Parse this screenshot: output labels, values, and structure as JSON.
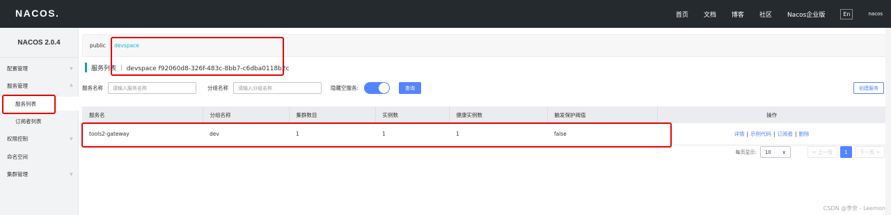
{
  "brand": {
    "logo": "NACOS."
  },
  "topnav": {
    "items": [
      "首页",
      "文档",
      "博客",
      "社区",
      "Nacos企业版"
    ],
    "lang": "En",
    "user": "nacos"
  },
  "sidebar": {
    "version": "NACOS 2.0.4",
    "items": [
      {
        "label": "配置管理",
        "chevron": "∨"
      },
      {
        "label": "服务管理",
        "chevron": "∧"
      },
      {
        "label": "服务列表"
      },
      {
        "label": "订阅者列表"
      },
      {
        "label": "权限控制",
        "chevron": "∨"
      },
      {
        "label": "命名空间"
      },
      {
        "label": "集群管理",
        "chevron": "∨"
      }
    ]
  },
  "breadcrumb": {
    "public": "public",
    "separator": "|",
    "active": "devspace"
  },
  "page_title": "服务列表 ｜ devspace  f92060d8-326f-483c-8bb7-c6dba0118b2c",
  "filters": {
    "service_label": "服务名称",
    "service_placeholder": "请输入服务名称",
    "group_label": "分组名称",
    "group_placeholder": "请输入分组名称",
    "hide_empty_label": "隐藏空服务:",
    "query_button": "查询",
    "create_button": "创建服务"
  },
  "table": {
    "headers": [
      "服务名",
      "分组名称",
      "集群数目",
      "实例数",
      "健康实例数",
      "触发保护阈值",
      "操作"
    ],
    "rows": [
      {
        "service": "tools2-gateway",
        "group": "dev",
        "clusters": "1",
        "instances": "1",
        "healthy": "1",
        "threshold": "false"
      }
    ],
    "actions": {
      "detail": "详情",
      "sample": "示例代码",
      "subscribers": "订阅者",
      "delete": "删除",
      "sep": "|"
    }
  },
  "pagination": {
    "page_size_label": "每页显示:",
    "page_size": "10",
    "prev": "< 上一页",
    "current": "1",
    "next": "下一页 >"
  },
  "watermark": "CSDN @李奈 - Leemon",
  "colors": {
    "topbar": "#252a2f",
    "primary": "#5584ff",
    "highlight": "#e50000",
    "accent": "#0aa0c8"
  }
}
